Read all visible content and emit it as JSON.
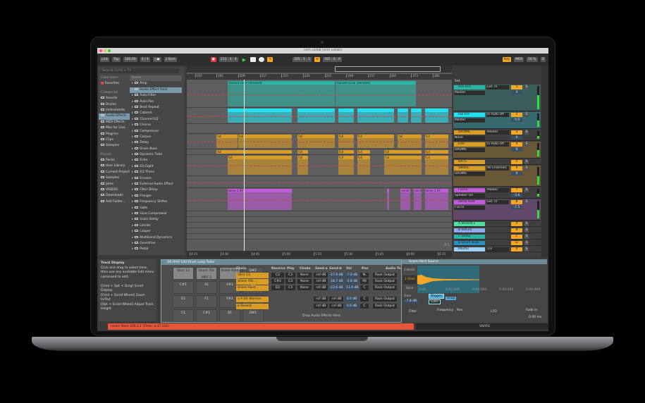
{
  "window": {
    "title": "snm collab  [snm collab]"
  },
  "transport": {
    "link": "Link",
    "tap": "Tap",
    "tempo": "180.00",
    "time_sig": "4 / 4",
    "metro": "○●",
    "quantize": "1 Bars",
    "position": "211 .  4 .  4",
    "loop_start": "205 .  1 .  1",
    "loop_length": "105 .  0 .  0",
    "key": "Key",
    "midi": "MIDI",
    "cpu": "16 %",
    "disk": "D"
  },
  "browser": {
    "search_placeholder": "Search (Cmd + F)",
    "collections_label": "Collections",
    "favorites": "Favorites",
    "categories_label": "Categories",
    "categories": [
      "Sounds",
      "Drums",
      "Instruments",
      "Audio Effects",
      "MIDI Effects",
      "Max for Live",
      "Plug-ins",
      "Clips",
      "Samples"
    ],
    "places_label": "Places",
    "places": [
      "Packs",
      "User Library",
      "Current Project",
      "Samples",
      "Jams",
      "VIDEOS",
      "Downloads",
      "Add Folder..."
    ],
    "name_header": "Name",
    "items": [
      "Amp",
      "Audio Effect Rack",
      "Auto Filter",
      "Auto Pan",
      "Beat Repeat",
      "Cabinet",
      "Channel EQ",
      "Chorus",
      "Compressor",
      "Corpus",
      "Delay",
      "Drum Buss",
      "Dynamic Tube",
      "Echo",
      "EQ Eight",
      "EQ Three",
      "Erosion",
      "External Audio Effect",
      "Filter Delay",
      "Flanger",
      "Frequency Shifter",
      "Gate",
      "Glue Compressor",
      "Grain Delay",
      "Limiter",
      "Looper",
      "Multiband Dynamics",
      "Overdrive",
      "Pedal"
    ]
  },
  "arrangement": {
    "bars": [
      "193",
      "201",
      "209",
      "217",
      "225",
      "233",
      "241",
      "249",
      "257",
      "265",
      "273",
      "281"
    ],
    "times": [
      "4:15",
      "4:30",
      "4:45",
      "5:00",
      "5:15",
      "5:30",
      "5:45",
      "6:00",
      "6:15"
    ],
    "page": "8/1",
    "bar_range": [
      190,
      288
    ],
    "lanes": [
      {
        "h": 39,
        "color": "#2bb5a5",
        "clips": [
          [
            205,
            245,
            "stacked vocal (demoed)"
          ],
          [
            245,
            275,
            "stacked vocal (demoed)"
          ]
        ]
      },
      {
        "h": 23,
        "color": "#22e0f0",
        "clips": [
          [
            205,
            229,
            ""
          ],
          [
            231,
            245,
            ""
          ],
          [
            246,
            252,
            ""
          ],
          [
            253,
            267,
            ""
          ],
          [
            268,
            272,
            ""
          ],
          [
            273,
            277,
            ""
          ],
          [
            278,
            287,
            ""
          ]
        ]
      },
      {
        "h": 14,
        "color": "#6a6a6a",
        "clips": []
      },
      {
        "h": 22,
        "color": "#d99c25",
        "clips": [
          [
            201,
            209,
            "full"
          ],
          [
            209,
            229,
            "full"
          ],
          [
            231,
            245,
            "full"
          ],
          [
            246,
            252,
            "full"
          ],
          [
            253,
            267,
            "full"
          ],
          [
            268,
            277,
            "full"
          ],
          [
            278,
            287,
            "full"
          ]
        ]
      },
      {
        "h": 8,
        "color": "#d99c25",
        "clips": [
          [
            201,
            229,
            "full"
          ],
          [
            231,
            235,
            "full"
          ],
          [
            246,
            252,
            "full"
          ],
          [
            253,
            258,
            "full"
          ],
          [
            263,
            277,
            "full"
          ],
          [
            278,
            287,
            "full"
          ]
        ]
      },
      {
        "h": 30,
        "color": "#d99c25",
        "clips": [
          [
            205,
            229,
            "full"
          ],
          [
            231,
            235,
            "full"
          ],
          [
            246,
            252,
            "full"
          ],
          [
            253,
            258,
            "full"
          ],
          [
            263,
            277,
            "full"
          ],
          [
            278,
            287,
            "full"
          ]
        ]
      },
      {
        "h": 17,
        "color": "#6a6a6a",
        "clips": []
      },
      {
        "h": 33,
        "color": "#c05cd8",
        "clips": [
          [
            205,
            229,
            "verse 1 (Fr"
          ],
          [
            264,
            265,
            ""
          ],
          [
            269,
            273,
            "verse"
          ],
          [
            274,
            277,
            "verse"
          ],
          [
            278,
            287,
            "verse 1 (Fr"
          ]
        ]
      },
      {
        "h": 8,
        "color": "#5e5e5e",
        "clips": []
      },
      {
        "h": 8,
        "color": "#5e5e5e",
        "clips": []
      },
      {
        "h": 8,
        "color": "#5e5e5e",
        "clips": []
      },
      {
        "h": 8,
        "color": "#5e5e5e",
        "clips": []
      },
      {
        "h": 8,
        "color": "#5e5e5e",
        "clips": []
      }
    ]
  },
  "mixer": {
    "set_label": "Set",
    "tracks": [
      {
        "name": "VOCALS",
        "color": "#2bb5a5",
        "input": "Ext. In",
        "output": "Master",
        "num": "1",
        "vol": "0",
        "meter": 0.6,
        "h": 38
      },
      {
        "name": "hat fire",
        "color": "#22e0f0",
        "input": "In Auto Off",
        "output": "Master",
        "num": "2",
        "vol": "-5.0",
        "meter": 0.5,
        "h": 24
      },
      {
        "name": "DRUMS",
        "color": "#d99c25",
        "input": "Master",
        "output": "None",
        "num": "3",
        "vol": "0",
        "meter": 0.4,
        "h": 16
      },
      {
        "name": "kick",
        "color": "#d99c25",
        "input": "In Auto Off",
        "output": "DRUMS",
        "num": "4",
        "vol": "0",
        "meter": 0.5,
        "h": 24
      },
      {
        "name": "HATS",
        "color": "#d99c25",
        "input": "",
        "output": "",
        "num": "5",
        "vol": "",
        "meter": 0.2,
        "h": 8
      },
      {
        "name": "SNARE",
        "color": "#d99c25",
        "input": "All Channels",
        "output": "DRUMS",
        "num": "6",
        "vol": "0",
        "meter": 0.5,
        "h": 30
      },
      {
        "name": "FLUTE",
        "color": "#c05cd8",
        "input": "Master",
        "output": "Speaker On",
        "num": "7",
        "vol": "-3.6",
        "meter": 0.4,
        "h": 16
      },
      {
        "name": "verse flute",
        "color": "#c05cd8",
        "input": "Ext. In",
        "output": "FLUTE",
        "num": "8",
        "vol": "-7.5",
        "meter": 0.5,
        "h": 30
      },
      {
        "name": "A Reverb L",
        "color": "#4ee0a0",
        "input": "",
        "output": "",
        "num": "A",
        "vol": "",
        "meter": 0,
        "h": 8
      },
      {
        "name": "B Return",
        "color": "#8fa8f0",
        "input": "",
        "output": "",
        "num": "B",
        "vol": "",
        "meter": 0,
        "h": 8
      },
      {
        "name": "C Delay",
        "color": "#2bb5a5",
        "input": "",
        "output": "",
        "num": "C",
        "vol": "",
        "meter": 0,
        "h": 8
      },
      {
        "name": "D Drum Buss",
        "color": "#2a8fc0",
        "input": "",
        "output": "",
        "num": "D",
        "vol": "",
        "meter": 0,
        "h": 8
      },
      {
        "name": "Master",
        "color": "#9ad0f5",
        "input": "1/2",
        "output": "",
        "num": "0",
        "vol": "",
        "meter": 0.3,
        "h": 8
      }
    ]
  },
  "info": {
    "title": "Track Display",
    "body": "Click and drag to select time, then use any available Edit menu command to edit.",
    "hint1": "[Cmd + Opt + Drag] Scroll Display",
    "hint2": "[Cmd + Scroll Wheel] Zoom In/Out",
    "hint3": "[Opt + Scroll Wheel] Adjust Track Height"
  },
  "rack": {
    "title": "OS HHH 140 Drum Loop Tudor",
    "pads": [
      "Slice 13",
      "Snare 70s MPC 2",
      "Snare Hard",
      "D#2",
      "C#1",
      "A1",
      "A#1",
      "B1",
      "E1",
      "F1",
      "F#1",
      "G1",
      "C1",
      "C#1",
      "D1",
      "D#1"
    ],
    "headers": [
      "Chain",
      "Receive",
      "Play",
      "Choke",
      "Send-a",
      "Send-b",
      "Vol",
      "Pan",
      "Audio To"
    ],
    "chains": [
      {
        "name": "Slice 13",
        "recv": "C2",
        "play": "C3",
        "choke": "None",
        "sa": "-inf dB",
        "sb": "-17.6 dB",
        "vol": "-7.0 dB",
        "pan": "9L",
        "out": "Rack Output"
      },
      {
        "name": "Snare 70s ...",
        "recv": "C#2",
        "play": "C3",
        "choke": "None",
        "sa": "-inf dB",
        "sb": "-18.7 dB",
        "vol": "-5.6 dB",
        "pan": "9R",
        "out": "Rack Output"
      },
      {
        "name": "Snare Hard...",
        "recv": "D2",
        "play": "C3",
        "choke": "None",
        "sa": "-inf dB",
        "sb": "-23.6 dB",
        "vol": "-11.6 dB",
        "pan": "C",
        "out": "Rack Output"
      }
    ],
    "returns": [
      {
        "name": "a A Bit Warmer",
        "sa": "-inf dB",
        "sb": "-inf dB",
        "vol": "0.0 dB",
        "pan": "C",
        "out": "Rack Output"
      },
      {
        "name": "b Reverb",
        "sa": "-inf dB",
        "sb": "-inf dB",
        "vol": "0.0 dB",
        "pan": "C",
        "out": "Rack Output"
      }
    ],
    "drop": "Drop Audio Effects Here"
  },
  "simpler": {
    "title": "Snare Hard Source",
    "modes": [
      "Classic",
      "1-Shot",
      "Slice"
    ],
    "gain_label": "Gain",
    "gain": "-7.8 dB",
    "btn1": "Trigger",
    "btn2": "Gate",
    "snap": "Snap",
    "times": [
      "0:00",
      "0:00:000",
      "0:00:000",
      "0:00:000",
      "0:00:000"
    ],
    "filter": "Filter",
    "frequency": "Frequency",
    "res": "Res",
    "lfo": "LFO",
    "fade_in": "Fade In",
    "fade_in_val": "0.00 ms"
  },
  "status": {
    "text": "Insert Mark 205.1.1 (Time: 4:37:310)",
    "track": "SNARE"
  }
}
